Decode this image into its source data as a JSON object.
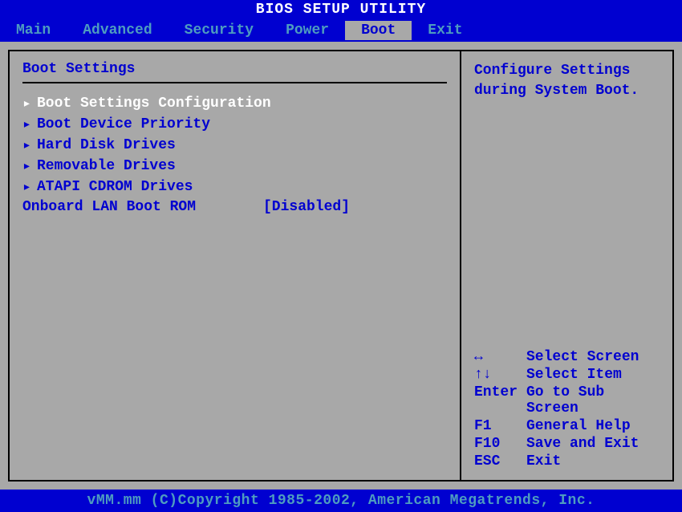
{
  "title": "BIOS SETUP UTILITY",
  "tabs": [
    {
      "label": "Main",
      "active": false
    },
    {
      "label": "Advanced",
      "active": false
    },
    {
      "label": "Security",
      "active": false
    },
    {
      "label": "Power",
      "active": false
    },
    {
      "label": "Boot",
      "active": true
    },
    {
      "label": "Exit",
      "active": false
    }
  ],
  "section": {
    "heading": "Boot Settings",
    "items": [
      {
        "label": "Boot Settings Configuration",
        "selected": true
      },
      {
        "label": "Boot Device Priority",
        "selected": false
      },
      {
        "label": "Hard Disk Drives",
        "selected": false
      },
      {
        "label": "Removable Drives",
        "selected": false
      },
      {
        "label": "ATAPI CDROM Drives",
        "selected": false
      }
    ],
    "options": [
      {
        "label": "Onboard LAN Boot ROM",
        "value": "[Disabled]"
      }
    ]
  },
  "help": {
    "line1": "Configure Settings",
    "line2": "during System Boot."
  },
  "keymap": [
    {
      "key": "↔",
      "action": "Select Screen"
    },
    {
      "key": "↑↓",
      "action": "Select Item"
    },
    {
      "key": "Enter",
      "action": "Go to Sub Screen"
    },
    {
      "key": "F1",
      "action": "General Help"
    },
    {
      "key": "F10",
      "action": "Save and Exit"
    },
    {
      "key": "ESC",
      "action": "Exit"
    }
  ],
  "footer": "vMM.mm (C)Copyright 1985-2002, American Megatrends, Inc.",
  "arrow_glyph": "▸"
}
